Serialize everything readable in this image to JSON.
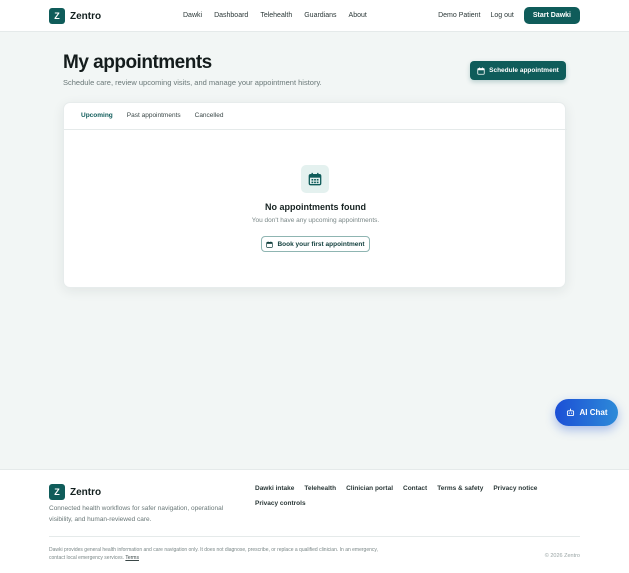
{
  "header": {
    "brand_letter": "Z",
    "brand_name": "Zentro",
    "nav": [
      "Dawki",
      "Dashboard",
      "Telehealth",
      "Guardians",
      "About"
    ],
    "user": "Demo Patient",
    "logout": "Log out",
    "cta": "Start Dawki"
  },
  "page": {
    "title": "My appointments",
    "subtitle": "Schedule care, review upcoming visits, and manage your appointment history.",
    "schedule_button": "Schedule appointment"
  },
  "tabs": [
    "Upcoming",
    "Past appointments",
    "Cancelled"
  ],
  "active_tab": "Upcoming",
  "empty_state": {
    "title": "No appointments found",
    "subtitle": "You don't have any upcoming appointments.",
    "button": "Book your first appointment",
    "icon": "calendar-icon"
  },
  "ai_chat": {
    "label": "AI Chat",
    "icon": "robot-icon"
  },
  "footer": {
    "brand_letter": "Z",
    "brand_name": "Zentro",
    "description": "Connected health workflows for safer navigation, operational visibility, and human-reviewed care.",
    "links": [
      "Dawki intake",
      "Telehealth",
      "Clinician portal",
      "Contact",
      "Terms & safety",
      "Privacy notice",
      "Privacy controls"
    ],
    "legal": "Dawki provides general health information and care navigation only. It does not diagnose, prescribe, or replace a qualified clinician. In an emergency, contact local emergency services.",
    "terms_link": "Terms",
    "copyright": "© 2026 Zentro"
  },
  "colors": {
    "primary": "#0f5c5a",
    "background": "#f2f6f5",
    "ai_chat_start": "#1c4fd6",
    "ai_chat_end": "#2d8ad8"
  }
}
